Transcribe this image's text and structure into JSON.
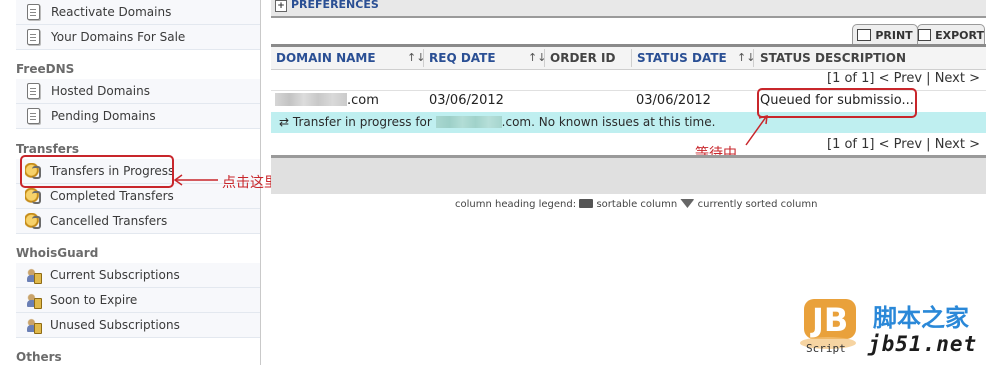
{
  "sidebar": {
    "reactivate": "Reactivate Domains",
    "for_sale": "Your Domains For Sale",
    "freedns_title": "FreeDNS",
    "hosted": "Hosted Domains",
    "pending": "Pending Domains",
    "transfers_title": "Transfers",
    "in_progress": "Transfers in Progress",
    "completed": "Completed Transfers",
    "cancelled": "Cancelled Transfers",
    "whoisguard_title": "WhoisGuard",
    "current_subs": "Current Subscriptions",
    "soon_expire": "Soon to Expire",
    "unused_subs": "Unused Subscriptions",
    "others_title": "Others"
  },
  "annotations": {
    "click_here": "点击这里",
    "waiting": "等待中",
    "color": "#c8262b"
  },
  "preferences_label": "PREFERENCES",
  "toolbar": {
    "print": "PRINT",
    "export": "EXPORT"
  },
  "table": {
    "headers": {
      "domain_name": "DOMAIN NAME",
      "req_date": "REQ DATE",
      "order_id": "ORDER ID",
      "status_date": "STATUS DATE",
      "status_description": "STATUS DESCRIPTION"
    },
    "pager": {
      "count": "[1 of 1]",
      "prev": "< Prev",
      "sep": "|",
      "next": "Next >"
    },
    "row": {
      "domain_suffix": ".com",
      "req_date": "03/06/2012",
      "order_id": "",
      "status_date": "03/06/2012",
      "status": "Queued for submissio..."
    },
    "message": {
      "prefix": "Transfer in progress for",
      "suffix": ".com. No known issues at this time."
    }
  },
  "legend": {
    "prefix": "column heading legend:",
    "sortable": "sortable column",
    "sorted": "currently sorted column"
  },
  "watermark": {
    "logo_text": "Script",
    "cn": "脚本之家",
    "url": "jb51.net"
  },
  "colors": {
    "link_blue": "#2a4f94",
    "message_bg": "#bfeff0",
    "watermark_blue": "#2a88d8"
  }
}
